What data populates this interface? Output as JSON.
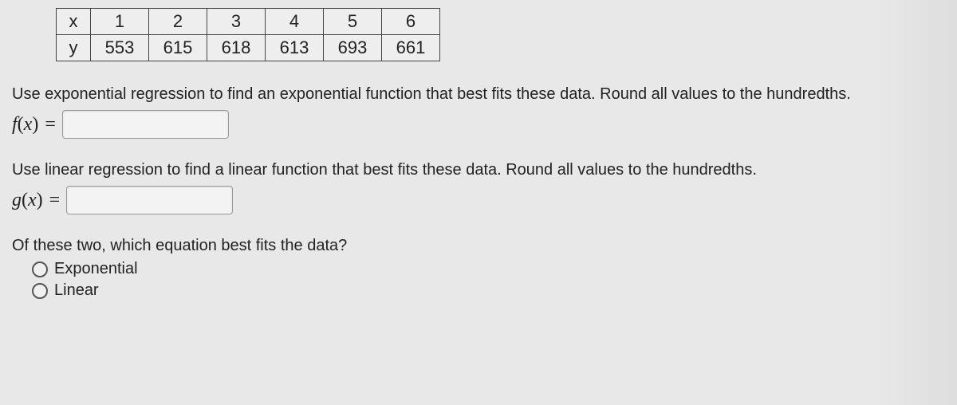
{
  "chart_data": {
    "type": "table",
    "rows": [
      {
        "label": "x",
        "values": [
          1,
          2,
          3,
          4,
          5,
          6
        ]
      },
      {
        "label": "y",
        "values": [
          553,
          615,
          618,
          613,
          693,
          661
        ]
      }
    ]
  },
  "q1": {
    "prompt": "Use exponential regression to find an exponential function that best fits these data. Round all values to the hundredths.",
    "fn_label": "f(x) =",
    "value": ""
  },
  "q2": {
    "prompt": "Use linear regression to find a linear function that best fits these data.  Round all values to the hundredths.",
    "fn_label": "g(x) =",
    "value": ""
  },
  "q3": {
    "prompt": "Of these two, which equation best fits the data?",
    "options": [
      "Exponential",
      "Linear"
    ]
  }
}
